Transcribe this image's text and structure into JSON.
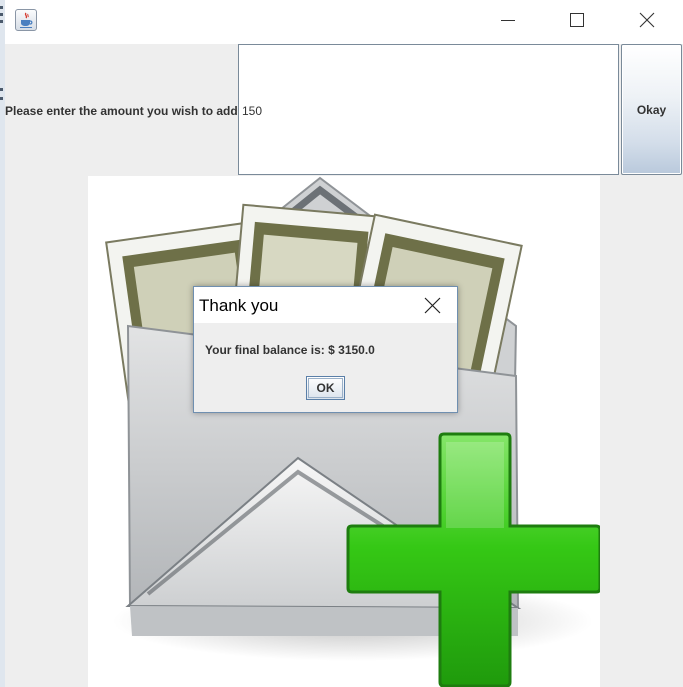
{
  "window": {
    "icon": "java-coffee-cup-icon",
    "controls": [
      "minimize-icon",
      "maximize-icon",
      "close-icon"
    ]
  },
  "form": {
    "prompt_label": "Please enter the amount you wish to add.",
    "amount_value": "150",
    "okay_label": "Okay"
  },
  "illustration": {
    "subject": "envelope-with-money-and-green-plus-icon",
    "colors": {
      "plus": "#2fc412",
      "envelope": "#d5d7d9",
      "bills": "#7b7d52"
    }
  },
  "dialog": {
    "title": "Thank you",
    "message": "Your final balance is: $ 3150.0",
    "ok_label": "OK"
  }
}
